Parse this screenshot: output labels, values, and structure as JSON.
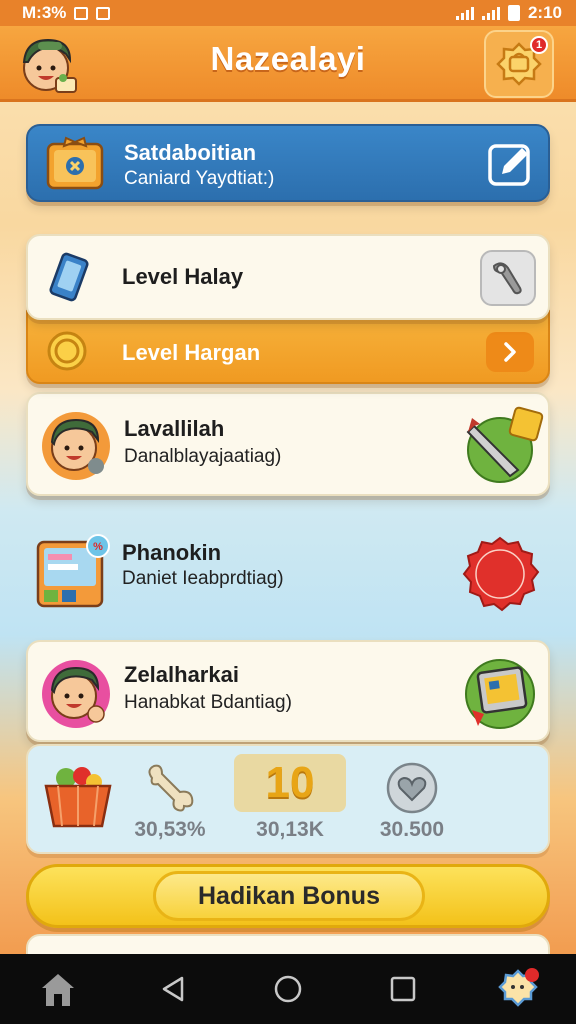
{
  "status_bar": {
    "left_text": "M:3%",
    "time": "2:10"
  },
  "header": {
    "title": "Nazealayi",
    "notification_count": "1"
  },
  "blue_card": {
    "title": "Satdaboitian",
    "subtitle": "Caniard Yaydtiat:)"
  },
  "level_card": {
    "title": "Level Halay"
  },
  "level_bar": {
    "title": "Level Hargan"
  },
  "items": [
    {
      "title": "Lavallilah",
      "subtitle": "Danalblayajaatiag)"
    },
    {
      "title": "Phanokin",
      "subtitle": "Daniet Ieabprdtiag)"
    },
    {
      "title": "Zelalharkai",
      "subtitle": "Hanabkat Bdantiag)"
    }
  ],
  "stats": {
    "stat1": "30,53%",
    "stat2": "30,13K",
    "stat3": "30.500",
    "highlight": "10"
  },
  "bonus": {
    "label": "Hadikan Bonus"
  },
  "colors": {
    "accent": "#ee8b2a",
    "primary_blue": "#2c6fae",
    "gold": "#f3c21a"
  }
}
